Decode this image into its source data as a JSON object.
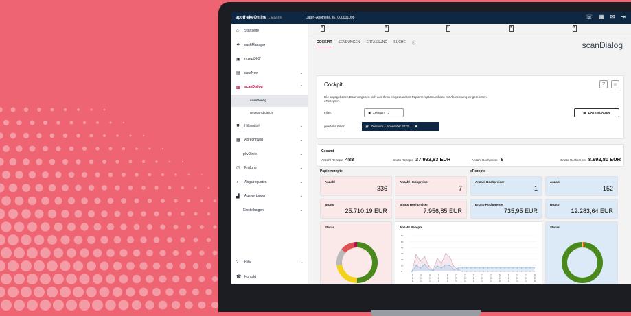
{
  "colors": {
    "background": "#ee6472",
    "topbar": "#0e2742",
    "accent": "#b3134a",
    "paper": "#fbe8e9",
    "erezept": "#dbeaf6",
    "green": "#4a8a1c",
    "yellow": "#f2d21b",
    "red": "#e05050",
    "gray": "#b9b9b9"
  },
  "topbar": {
    "brand": "apothekeOnline",
    "brand_sub": "⌄ NOVENTI",
    "pharmacy": "Daten-Apotheke, IK: 000001098",
    "icons": [
      "chat-icon",
      "grid-icon",
      "mail-icon",
      "logout-icon"
    ]
  },
  "sidebar": {
    "items": [
      {
        "label": "Startseite",
        "icon": "home-icon"
      },
      {
        "label": "cashManager",
        "icon": "cash-icon"
      },
      {
        "label": "rezept360°",
        "icon": "prescription-icon"
      },
      {
        "label": "dataNow",
        "icon": "document-icon",
        "chev": "⌄"
      },
      {
        "label": "scanDialog",
        "icon": "scan-icon",
        "chev": "⌃"
      }
    ],
    "sub": [
      "scanDialog",
      "Rezept-Abgleich"
    ],
    "items2": [
      {
        "label": "Hilfsmittel",
        "icon": "tools-icon",
        "chev": "⌄"
      },
      {
        "label": "Abrechnung",
        "icon": "billing-icon",
        "chev": "⌄"
      },
      {
        "label": "pkvDirekt",
        "icon": "",
        "chev": "⌄"
      },
      {
        "label": "Prüfung",
        "icon": "check-icon",
        "chev": "⌄"
      },
      {
        "label": "Abgabequoten",
        "icon": "pie-icon",
        "chev": "⌄"
      },
      {
        "label": "Auswertungen",
        "icon": "chart-icon",
        "chev": "⌄"
      },
      {
        "label": "Einstellungen",
        "icon": "",
        "chev": "⌄"
      }
    ],
    "footer": [
      {
        "label": "Hilfe",
        "icon": "help-icon",
        "chev": "⌄"
      },
      {
        "label": "Kontakt",
        "icon": "phone-icon"
      }
    ]
  },
  "tabs": [
    "COCKPIT",
    "SENDUNGEN",
    "ERFASSUNG",
    "SUCHE"
  ],
  "app_title": "scanDialog",
  "cockpit": {
    "title": "Cockpit",
    "description": "Die angegebenen Daten ergeben sich aus Ihren eingescannten Papierrezepten und den zur Abrechnung eingereichten eRezepten.",
    "filter_label": "Filter:",
    "filter_value": "Zeitraum",
    "active_filter_label": "gewählte Filter:",
    "active_filter_chip": "Zeitraum = November 2022",
    "load_button": "DATEN LADEN"
  },
  "gesamt": {
    "title": "Gesamt",
    "items": [
      {
        "label": "Anzahl Rezepte",
        "value": "488"
      },
      {
        "label": "Brutto Rezepte",
        "value": "37.993,83 EUR"
      },
      {
        "label": "Anzahl Hochpreiser",
        "value": "8"
      },
      {
        "label": "Brutto Hochpreiser",
        "value": "8.692,80 EUR"
      }
    ]
  },
  "papier": {
    "title": "Papierrezepte",
    "anzahl": {
      "label": "Anzahl",
      "value": "336"
    },
    "anzahl_hp": {
      "label": "Anzahl Hochpreiser",
      "value": "7"
    },
    "brutto": {
      "label": "Brutto",
      "value": "25.710,19 EUR"
    },
    "brutto_hp": {
      "label": "Brutto Hochpreiser",
      "value": "7.956,85 EUR"
    },
    "status": {
      "label": "Status"
    }
  },
  "erezepte": {
    "title": "eRezepte",
    "anzahl_hp": {
      "label": "Anzahl Hochpreiser",
      "value": "1"
    },
    "anzahl": {
      "label": "Anzahl",
      "value": "152"
    },
    "brutto_hp": {
      "label": "Brutto Hochpreiser",
      "value": "735,95 EUR"
    },
    "brutto": {
      "label": "Brutto",
      "value": "12.283,64 EUR"
    },
    "status": {
      "label": "Status"
    }
  },
  "line_chart": {
    "title": "Anzahl Rezepte",
    "x_labels": [
      "01.11.22",
      "03.11.22",
      "05.11.22",
      "07.11.22",
      "09.11.22",
      "11.11.22",
      "13.11.22",
      "15.11.22",
      "17.11.22",
      "19.11.22",
      "21.11.22",
      "23.11.22",
      "25.11.22",
      "27.11.22",
      "29.11.22"
    ],
    "y_labels": [
      "0",
      "10",
      "20",
      "30",
      "40",
      "50",
      "60"
    ]
  }
}
